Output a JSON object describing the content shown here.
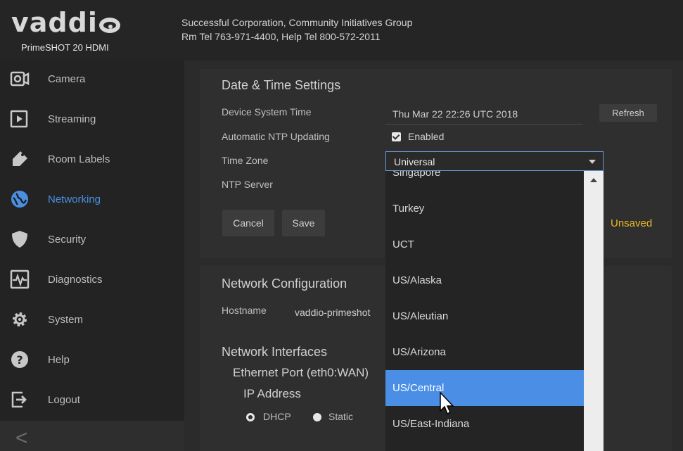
{
  "header": {
    "logo_text": "vaddi",
    "product": "PrimeSHOT 20 HDMI",
    "company": "Successful Corporation, Community Initiatives Group",
    "contact": "Rm Tel 763-971-4400, Help Tel 800-572-2011"
  },
  "sidebar": {
    "items": [
      {
        "label": "Camera",
        "icon": "camera-icon"
      },
      {
        "label": "Streaming",
        "icon": "play-icon"
      },
      {
        "label": "Room Labels",
        "icon": "tag-icon"
      },
      {
        "label": "Networking",
        "icon": "globe-icon",
        "active": true
      },
      {
        "label": "Security",
        "icon": "shield-icon"
      },
      {
        "label": "Diagnostics",
        "icon": "pulse-icon"
      },
      {
        "label": "System",
        "icon": "gear-icon"
      },
      {
        "label": "Help",
        "icon": "help-icon"
      },
      {
        "label": "Logout",
        "icon": "logout-icon"
      }
    ],
    "collapse_glyph": "<"
  },
  "datetime": {
    "title": "Date & Time Settings",
    "system_time_label": "Device System Time",
    "system_time_value": "Thu Mar 22 22:26 UTC 2018",
    "refresh_label": "Refresh",
    "ntp_update_label": "Automatic NTP Updating",
    "ntp_update_value": "Enabled",
    "timezone_label": "Time Zone",
    "timezone_value": "Universal",
    "ntp_server_label": "NTP Server",
    "cancel_label": "Cancel",
    "save_label": "Save",
    "status": "Unsaved"
  },
  "timezone_dropdown": {
    "options": [
      "Singapore",
      "Turkey",
      "UCT",
      "US/Alaska",
      "US/Aleutian",
      "US/Arizona",
      "US/Central",
      "US/East-Indiana"
    ],
    "highlighted": "US/Central"
  },
  "network": {
    "title": "Network Configuration",
    "hostname_label": "Hostname",
    "hostname_value": "vaddio-primeshot",
    "interfaces_title": "Network Interfaces",
    "port_title": "Ethernet Port (eth0:WAN)",
    "ip_title": "IP Address",
    "dhcp_label": "DHCP",
    "static_label": "Static"
  },
  "colors": {
    "accent": "#4a90e2",
    "unsaved": "#e8b923",
    "highlight": "#4a8ee6"
  }
}
